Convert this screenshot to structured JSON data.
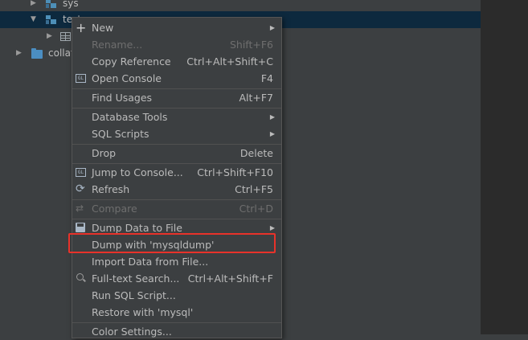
{
  "tree": {
    "rows": [
      {
        "label": "sys"
      },
      {
        "label": "test"
      },
      {
        "label": ""
      },
      {
        "label": "collations"
      }
    ]
  },
  "menu": {
    "items": [
      {
        "id": "new",
        "label": "New",
        "shortcut": "",
        "submenu": true,
        "disabled": false,
        "icon": "plus-icon"
      },
      {
        "id": "rename",
        "label": "Rename...",
        "shortcut": "Shift+F6",
        "submenu": false,
        "disabled": true,
        "icon": ""
      },
      {
        "id": "copy-reference",
        "label": "Copy Reference",
        "shortcut": "Ctrl+Alt+Shift+C",
        "submenu": false,
        "disabled": false,
        "icon": ""
      },
      {
        "id": "open-console",
        "label": "Open Console",
        "shortcut": "F4",
        "submenu": false,
        "disabled": false,
        "icon": "console-icon"
      },
      {
        "id": "find-usages",
        "label": "Find Usages",
        "shortcut": "Alt+F7",
        "submenu": false,
        "disabled": false,
        "icon": ""
      },
      {
        "id": "database-tools",
        "label": "Database Tools",
        "shortcut": "",
        "submenu": true,
        "disabled": false,
        "icon": ""
      },
      {
        "id": "sql-scripts",
        "label": "SQL Scripts",
        "shortcut": "",
        "submenu": true,
        "disabled": false,
        "icon": ""
      },
      {
        "id": "drop",
        "label": "Drop",
        "shortcut": "Delete",
        "submenu": false,
        "disabled": false,
        "icon": ""
      },
      {
        "id": "jump-to-console",
        "label": "Jump to Console...",
        "shortcut": "Ctrl+Shift+F10",
        "submenu": false,
        "disabled": false,
        "icon": "console-icon"
      },
      {
        "id": "refresh",
        "label": "Refresh",
        "shortcut": "Ctrl+F5",
        "submenu": false,
        "disabled": false,
        "icon": "refresh-icon"
      },
      {
        "id": "compare",
        "label": "Compare",
        "shortcut": "Ctrl+D",
        "submenu": false,
        "disabled": true,
        "icon": "compare-icon"
      },
      {
        "id": "dump-data-to-file",
        "label": "Dump Data to File",
        "shortcut": "",
        "submenu": true,
        "disabled": false,
        "icon": "save-icon"
      },
      {
        "id": "dump-with-mysqldump",
        "label": "Dump with 'mysqldump'",
        "shortcut": "",
        "submenu": false,
        "disabled": false,
        "icon": ""
      },
      {
        "id": "import-data-from-file",
        "label": "Import Data from File...",
        "shortcut": "",
        "submenu": false,
        "disabled": false,
        "icon": ""
      },
      {
        "id": "full-text-search",
        "label": "Full-text Search...",
        "shortcut": "Ctrl+Alt+Shift+F",
        "submenu": false,
        "disabled": false,
        "icon": "search-icon"
      },
      {
        "id": "run-sql-script",
        "label": "Run SQL Script...",
        "shortcut": "",
        "submenu": false,
        "disabled": false,
        "icon": ""
      },
      {
        "id": "restore-with-mysql",
        "label": "Restore with 'mysql'",
        "shortcut": "",
        "submenu": false,
        "disabled": false,
        "icon": ""
      },
      {
        "id": "color-settings",
        "label": "Color Settings...",
        "shortcut": "",
        "submenu": false,
        "disabled": false,
        "icon": ""
      }
    ],
    "console_icon_text": "GL",
    "submenu_glyph": "▶"
  },
  "colors": {
    "background": "#3c3f41",
    "selection": "#0d293e",
    "highlight_box": "#e8322a",
    "text": "#bbbbbb",
    "disabled_text": "#6e6e6e"
  }
}
